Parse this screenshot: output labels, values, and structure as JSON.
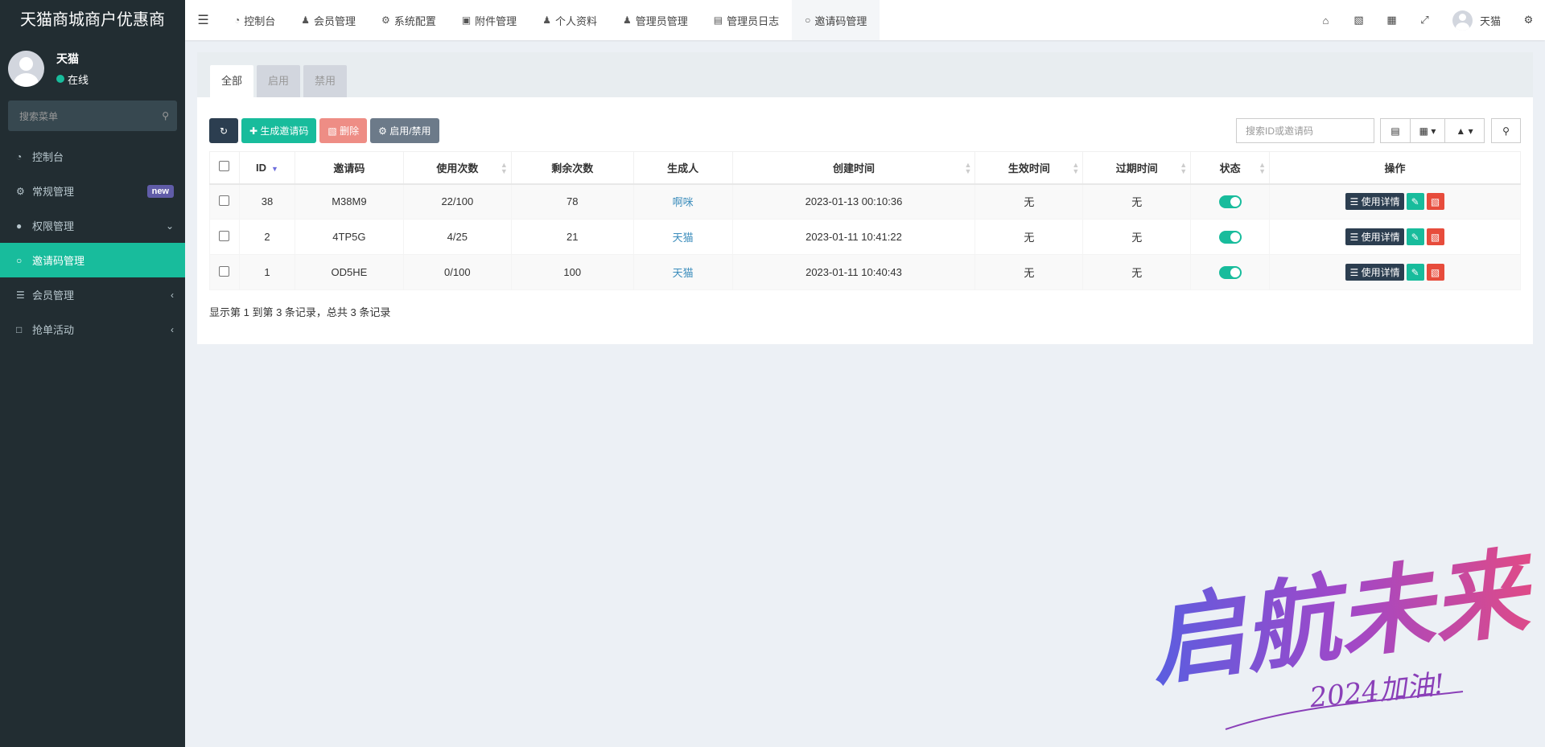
{
  "sidebar": {
    "logo": "天猫商城商户优惠商",
    "user": {
      "name": "天猫",
      "status": "在线"
    },
    "search_placeholder": "搜索菜单",
    "menu": [
      {
        "label": "控制台",
        "icon": "dashboard-icon"
      },
      {
        "label": "常规管理",
        "icon": "cogs-icon",
        "badge": "new"
      },
      {
        "label": "权限管理",
        "icon": "users-icon"
      },
      {
        "label": "邀请码管理",
        "icon": "circle-icon"
      },
      {
        "label": "会员管理",
        "icon": "list-icon"
      },
      {
        "label": "抢单活动",
        "icon": "bookmark-icon"
      }
    ]
  },
  "header": {
    "tabs": [
      {
        "label": "控制台"
      },
      {
        "label": "会员管理"
      },
      {
        "label": "系统配置"
      },
      {
        "label": "附件管理"
      },
      {
        "label": "个人资料"
      },
      {
        "label": "管理员管理"
      },
      {
        "label": "管理员日志"
      },
      {
        "label": "邀请码管理"
      }
    ],
    "user_name": "天猫"
  },
  "panel": {
    "tabs": [
      "全部",
      "启用",
      "禁用"
    ],
    "toolbar": {
      "generate": "生成邀请码",
      "delete": "删除",
      "toggle": "启用/禁用",
      "search_placeholder": "搜索ID或邀请码"
    },
    "columns": [
      "ID",
      "邀请码",
      "使用次数",
      "剩余次数",
      "生成人",
      "创建时间",
      "生效时间",
      "过期时间",
      "状态",
      "操作"
    ],
    "rows": [
      {
        "id": "38",
        "code": "M38M9",
        "used": "22/100",
        "remaining": "78",
        "creator": "啊咪",
        "created": "2023-01-13 00:10:36",
        "effective": "无",
        "expire": "无",
        "enabled": true
      },
      {
        "id": "2",
        "code": "4TP5G",
        "used": "4/25",
        "remaining": "21",
        "creator": "天猫",
        "created": "2023-01-11 10:41:22",
        "effective": "无",
        "expire": "无",
        "enabled": true
      },
      {
        "id": "1",
        "code": "OD5HE",
        "used": "0/100",
        "remaining": "100",
        "creator": "天猫",
        "created": "2023-01-11 10:40:43",
        "effective": "无",
        "expire": "无",
        "enabled": true
      }
    ],
    "row_actions": {
      "detail": "使用详情"
    },
    "summary": "显示第 1 到第 3 条记录，总共 3 条记录"
  },
  "watermark": {
    "main": "启航未来",
    "sub": "2024加油!"
  },
  "colors": {
    "accent": "#18bc9c",
    "sidebar": "#222d32",
    "danger": "#e74c3c",
    "dark": "#2c3e50"
  }
}
